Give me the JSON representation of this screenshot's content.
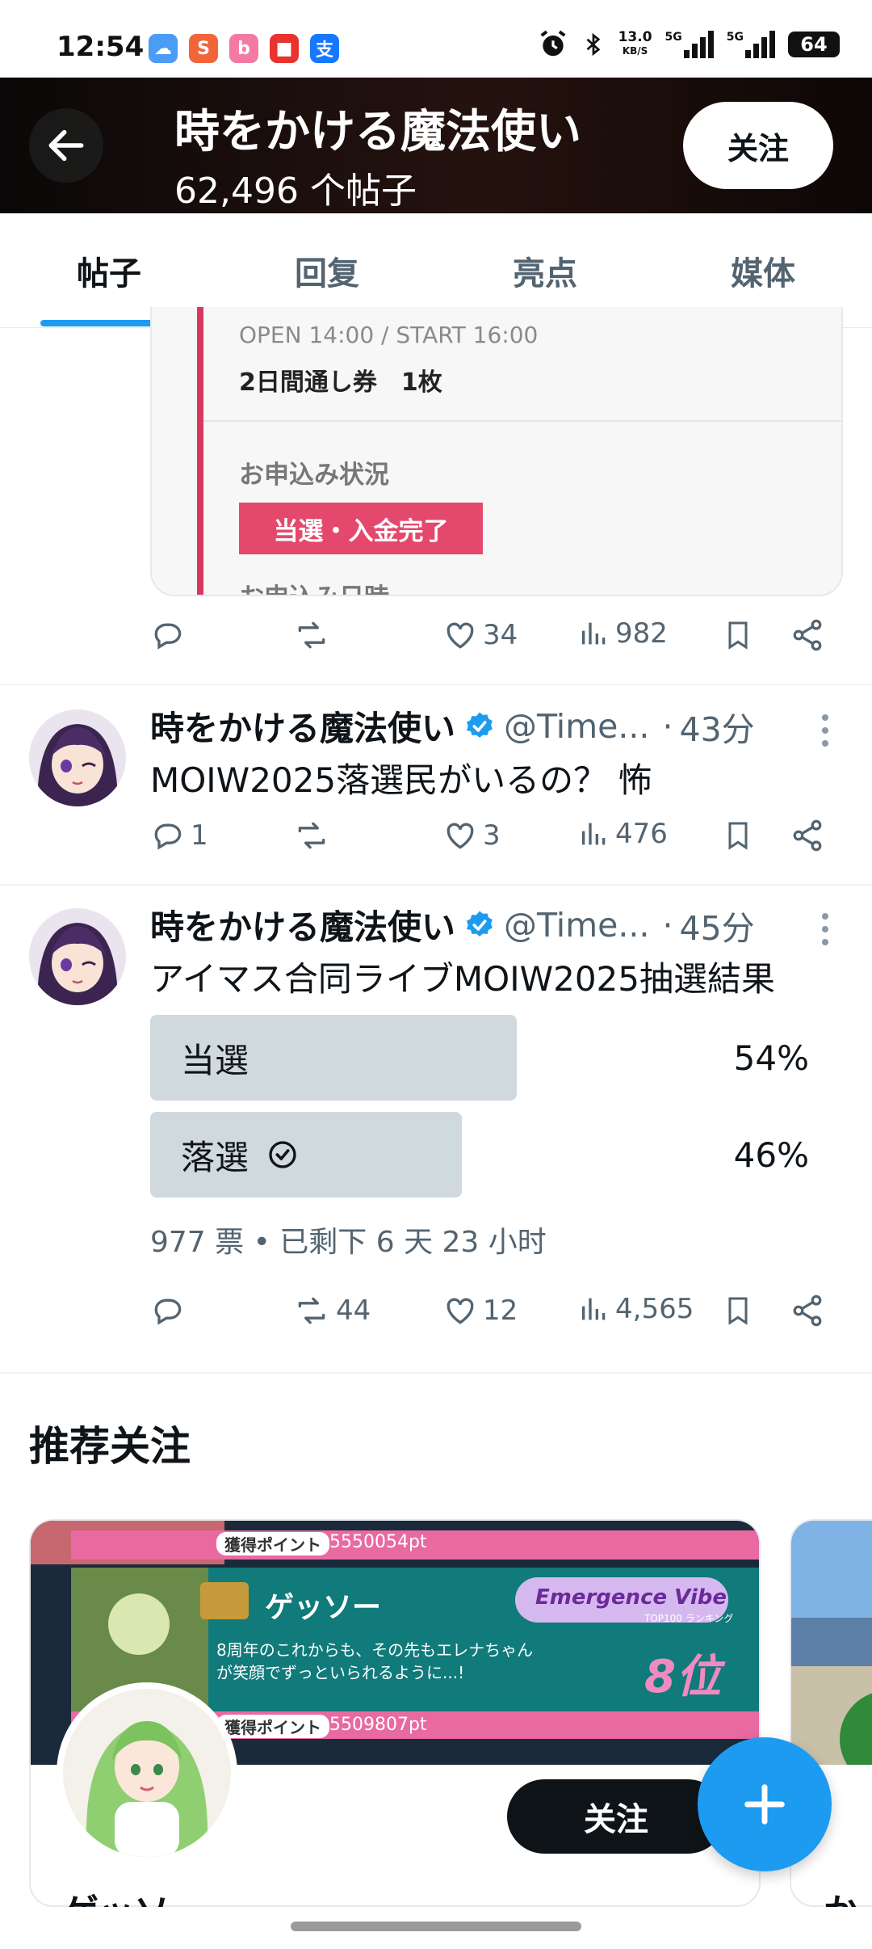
{
  "status_bar": {
    "time": "12:54",
    "net_speed_value": "13.0",
    "net_speed_unit": "KB/S",
    "sim1": "5G",
    "sim2": "5G",
    "battery": "64",
    "apps": [
      "weather-app",
      "s-app",
      "bilibili-app",
      "red-envelope-app",
      "alipay-app"
    ]
  },
  "header": {
    "title": "時をかける魔法使い",
    "post_count": "62,496 个帖子",
    "follow_label": "关注"
  },
  "tabs": [
    {
      "label": "帖子",
      "active": true
    },
    {
      "label": "回复",
      "active": false
    },
    {
      "label": "亮点",
      "active": false
    },
    {
      "label": "媒体",
      "active": false
    }
  ],
  "embed": {
    "line1": "OPEN 14:00 / START 16:00",
    "line2": "2日間通し券　1枚",
    "section": "お申込み状況",
    "badge": "当選・入金完了",
    "line4": "お申込み日時"
  },
  "post1_actions": {
    "replies": "",
    "reposts": "",
    "likes": "34",
    "views": "982"
  },
  "tweet2": {
    "name": "時をかける魔法使い",
    "handle": "@Time...",
    "dot": "·",
    "time": "43分",
    "text": "MOIW2025落選民がいるの？ 怖",
    "actions": {
      "replies": "1",
      "reposts": "",
      "likes": "3",
      "views": "476"
    }
  },
  "tweet3": {
    "name": "時をかける魔法使い",
    "handle": "@Time...",
    "dot": "·",
    "time": "45分",
    "text": "アイマス合同ライブMOIW2025抽選結果",
    "poll": [
      {
        "label": "当選",
        "percent": "54%",
        "fraction": 0.54,
        "selected": false
      },
      {
        "label": "落選",
        "percent": "46%",
        "fraction": 0.46,
        "selected": true
      }
    ],
    "poll_meta": "977 票 • 已剩下 6 天 23 小时",
    "actions": {
      "replies": "",
      "reposts": "44",
      "likes": "12",
      "views": "4,565"
    }
  },
  "recommend": {
    "title": "推荐关注",
    "card1": {
      "banner_point1": "獲得ポイント",
      "banner_pt1": "5550054pt",
      "banner_name": "ゲッソー",
      "banner_event": "Emergence Vibe",
      "banner_rank_label": "TOP100 ランキング",
      "banner_msg1": "8周年のこれからも、その先もエレナちゃん",
      "banner_msg2": "が笑顔でずっといられるように...!",
      "banner_rank": "8位",
      "banner_point2": "獲得ポイント",
      "banner_pt2": "5509807pt",
      "follow_label": "关注",
      "name": "ゲッソー"
    },
    "card2": {
      "name": "か"
    }
  },
  "colors": {
    "accent": "#1d9bf0",
    "badge": "#e4486c",
    "text_secondary": "#536471"
  },
  "icons": [
    "back-arrow-icon",
    "verified-icon",
    "reply-icon",
    "repost-icon",
    "like-icon",
    "views-icon",
    "bookmark-icon",
    "share-icon",
    "more-icon",
    "check-circle-icon",
    "plus-icon"
  ]
}
